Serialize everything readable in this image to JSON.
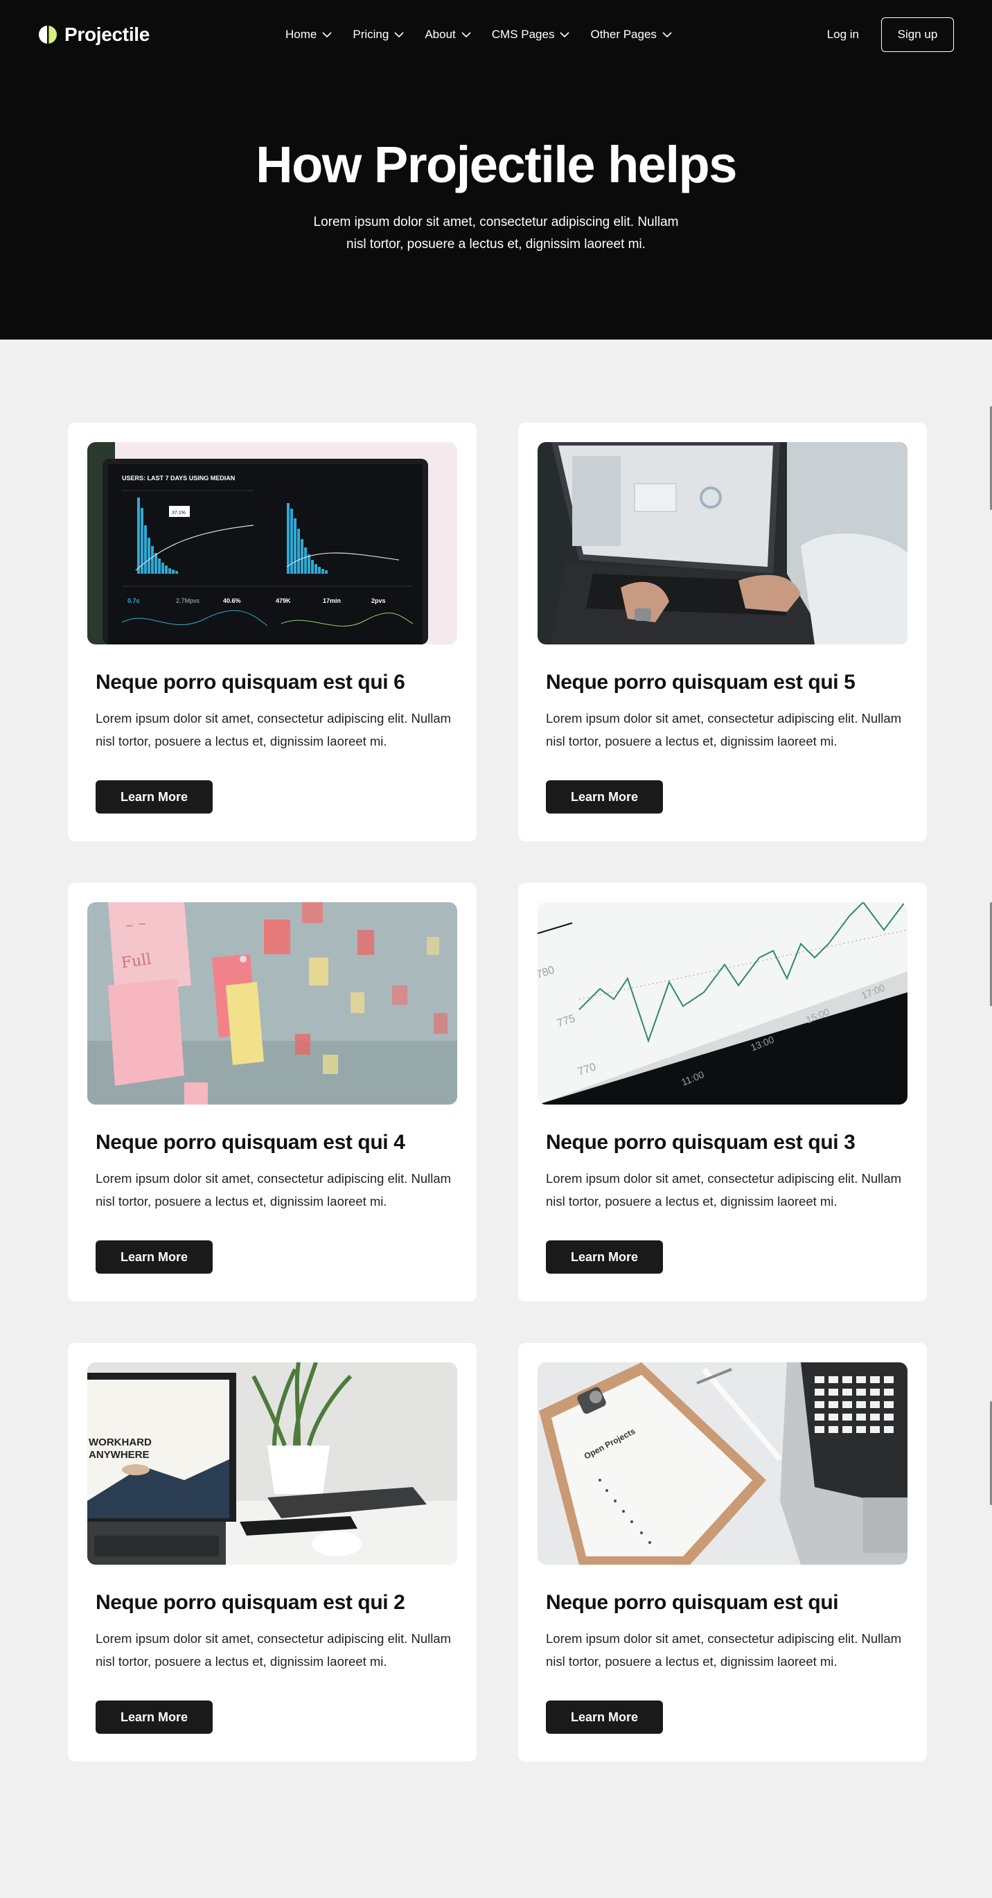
{
  "brand": {
    "name": "Projectile"
  },
  "nav": {
    "items": [
      {
        "label": "Home"
      },
      {
        "label": "Pricing"
      },
      {
        "label": "About"
      },
      {
        "label": "CMS Pages"
      },
      {
        "label": "Other Pages"
      }
    ],
    "login_label": "Log in",
    "signup_label": "Sign up"
  },
  "hero": {
    "title": "How Projectile helps",
    "subtitle": "Lorem ipsum dolor sit amet, consectetur adipiscing elit. Nullam nisl tortor, posuere a lectus et, dignissim laoreet mi."
  },
  "cards": [
    {
      "title": "Neque porro quisquam est qui 6",
      "text": "Lorem ipsum dolor sit amet, consectetur adipiscing elit. Nullam nisl tortor, posuere a lectus et, dignissim laoreet mi.",
      "button": "Learn More",
      "image": "analytics-dashboard-laptop"
    },
    {
      "title": "Neque porro quisquam est qui 5",
      "text": "Lorem ipsum dolor sit amet, consectetur adipiscing elit. Nullam nisl tortor, posuere a lectus et, dignissim laoreet mi.",
      "button": "Learn More",
      "image": "hands-typing-laptop"
    },
    {
      "title": "Neque porro quisquam est qui 4",
      "text": "Lorem ipsum dolor sit amet, consectetur adipiscing elit. Nullam nisl tortor, posuere a lectus et, dignissim laoreet mi.",
      "button": "Learn More",
      "image": "sticky-notes-wall"
    },
    {
      "title": "Neque porro quisquam est qui 3",
      "text": "Lorem ipsum dolor sit amet, consectetur adipiscing elit. Nullam nisl tortor, posuere a lectus et, dignissim laoreet mi.",
      "button": "Learn More",
      "image": "line-graph-paper"
    },
    {
      "title": "Neque porro quisquam est qui 2",
      "text": "Lorem ipsum dolor sit amet, consectetur adipiscing elit. Nullam nisl tortor, posuere a lectus et, dignissim laoreet mi.",
      "button": "Learn More",
      "image": "desk-laptop-plant"
    },
    {
      "title": "Neque porro quisquam est qui",
      "text": "Lorem ipsum dolor sit amet, consectetur adipiscing elit. Nullam nisl tortor, posuere a lectus et, dignissim laoreet mi.",
      "button": "Learn More",
      "image": "clipboard-open-projects"
    }
  ],
  "image_text": {
    "dash_header": "USERS: LAST 7 DAYS USING MEDIAN",
    "dash_metric_1": "0.7s",
    "dash_metric_2": "2.7Mpvs",
    "dash_metric_3": "40.6%",
    "dash_metric_4": "479K",
    "dash_metric_5": "17min",
    "dash_metric_6": "2pvs",
    "dash_tooltip": "37.1%",
    "graph_y_1": "780",
    "graph_y_2": "775",
    "graph_y_3": "770",
    "graph_x_1": "11:00",
    "graph_x_2": "13:00",
    "graph_x_3": "15:00",
    "graph_x_4": "17:00",
    "screen_line_1": "WORKHARD",
    "screen_line_2": "ANYWHERE",
    "clipboard_title": "Open Projects"
  },
  "colors": {
    "hero_bg": "#0b0b0b",
    "page_bg": "#f0f0f0",
    "button_bg": "#1a1a1a",
    "brand_accent": "#d6f07a"
  }
}
